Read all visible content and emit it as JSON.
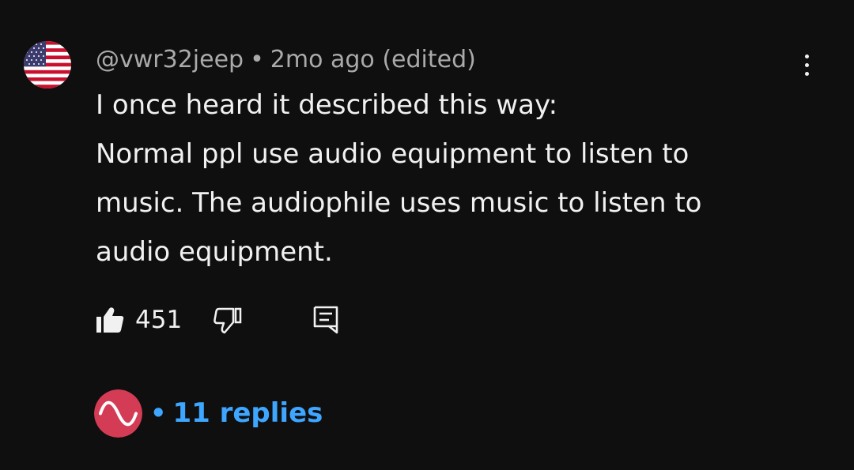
{
  "comment": {
    "author": "@vwr32jeep",
    "separator": "•",
    "time": "2mo ago (edited)",
    "avatar_icon": "us-flag-avatar",
    "text_lines": [
      "I once heard it described this way:",
      "Normal ppl use audio equipment to listen to",
      "music. The audiophile uses music to listen to",
      "audio equipment."
    ]
  },
  "actions": {
    "like_count": "451",
    "like_icon": "thumbs-up-icon",
    "dislike_icon": "thumbs-down-icon",
    "reply_icon": "comment-icon",
    "more_icon": "more-vertical-icon"
  },
  "replies": {
    "separator": "•",
    "label": "11 replies",
    "creator_avatar_icon": "creator-wave-avatar"
  },
  "colors": {
    "background": "#0f0f0f",
    "text": "#f1f1f1",
    "meta": "#aaaaaa",
    "link": "#3ea6ff",
    "creator_avatar": "#d43b55"
  }
}
